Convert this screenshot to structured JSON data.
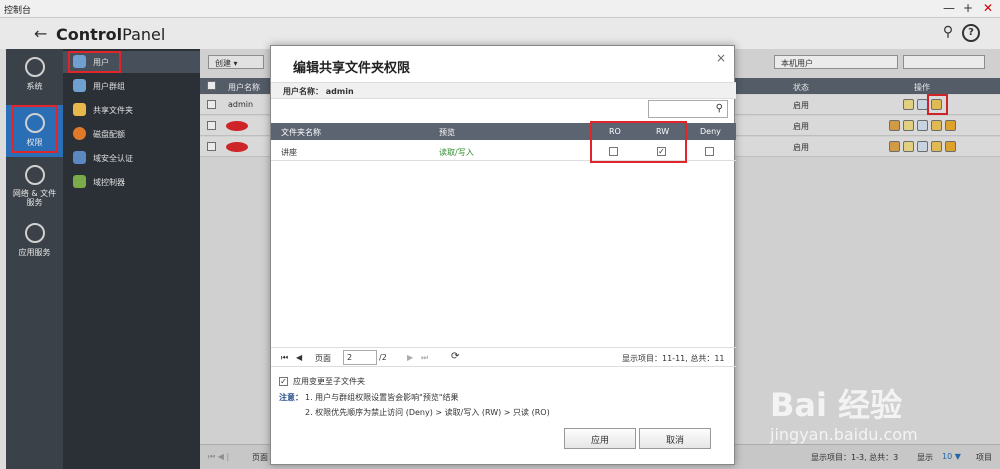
{
  "window": {
    "title": "控制台",
    "controls": [
      "—",
      "+",
      "✕"
    ]
  },
  "header": {
    "back": "←",
    "title_a": "Control",
    "title_b": "Panel",
    "search": "⚲",
    "help": "?"
  },
  "leftbar": [
    {
      "label": "系统"
    },
    {
      "label": "权限"
    },
    {
      "label": "网络 & 文件服务"
    },
    {
      "label": "应用服务"
    }
  ],
  "subnav": [
    {
      "label": "用户"
    },
    {
      "label": "用户群组"
    },
    {
      "label": "共享文件夹"
    },
    {
      "label": "磁盘配额"
    },
    {
      "label": "域安全认证"
    },
    {
      "label": "域控制器"
    }
  ],
  "main": {
    "create_button": "创建 ▾",
    "domain_select": "本机用户",
    "grid_headers": {
      "name": "用户名称",
      "status": "状态",
      "ops": "操作"
    },
    "rows": [
      {
        "name": "admin",
        "status": "启用"
      },
      {
        "name": "",
        "status": "启用"
      },
      {
        "name": "",
        "status": "启用"
      }
    ],
    "pager_left": "页面",
    "status_text": "显示项目：1-3, 总共：3",
    "page_size_label": "显示",
    "page_size": "10 ▼",
    "items_label": "项目"
  },
  "dialog": {
    "title": "编辑共享文件夹权限",
    "close": "×",
    "user_label": "用户名称： admin",
    "headers": {
      "folder": "文件夹名称",
      "preview": "预览",
      "ro": "RO",
      "rw": "RW",
      "deny": "Deny"
    },
    "rows": [
      {
        "folder": "讲座",
        "preview": "读取/写入",
        "ro": false,
        "rw": true,
        "deny": false
      }
    ],
    "pager": {
      "page_label": "页面",
      "page_value": "2",
      "page_total": "/2",
      "display": "显示项目：11-11, 总共：11"
    },
    "apply_sub": "应用变更至子文件夹",
    "note_label": "注意：",
    "note1": "1. 用户与群组权限设置皆会影响\"预览\"结果",
    "note2": "2. 权限优先顺序为禁止访问 (Deny) > 读取/写入 (RW) > 只读 (RO)",
    "apply_btn": "应用",
    "cancel_btn": "取消"
  },
  "watermark": {
    "text": "Bai 经验",
    "url": "jingyan.baidu.com"
  },
  "colors": {
    "highlight": "#e0262b",
    "sidebar": "#3b4148",
    "subnav": "#2b3036",
    "grid_header": "#5b6470",
    "preview_green": "#2e8b2e"
  }
}
